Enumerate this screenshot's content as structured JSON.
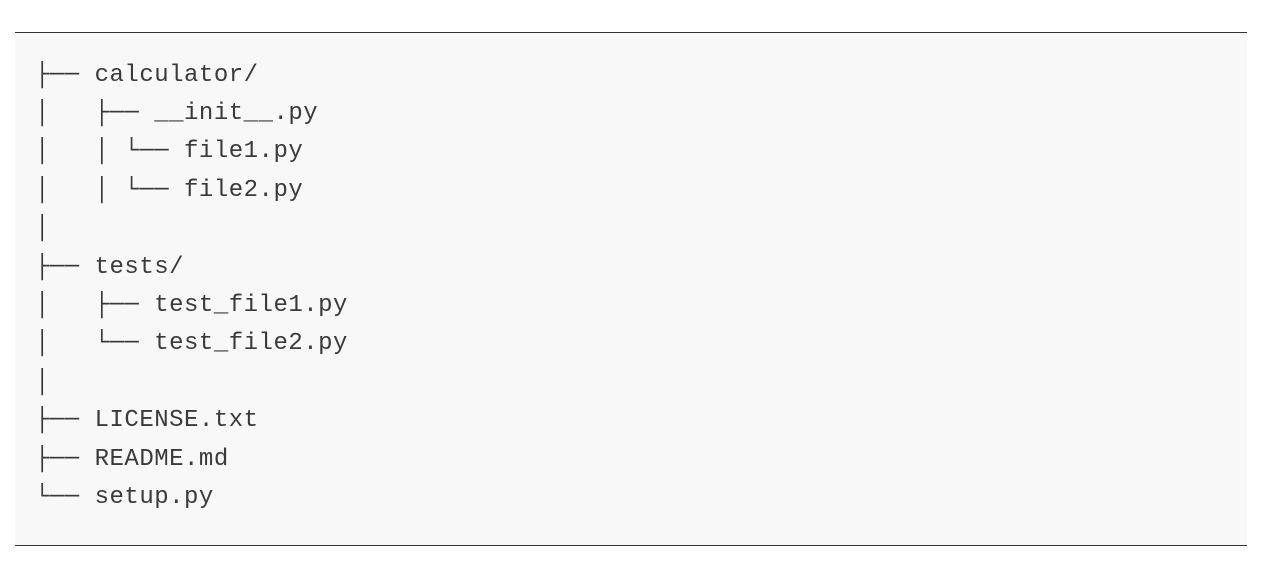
{
  "tree": {
    "lines": [
      "├── calculator/",
      "│   ├── __init__.py",
      "│   │ └── file1.py",
      "│   │ └── file2.py",
      "│",
      "├── tests/",
      "│   ├── test_file1.py",
      "│   └── test_file2.py",
      "│",
      "├── LICENSE.txt",
      "├── README.md",
      "└── setup.py"
    ]
  }
}
